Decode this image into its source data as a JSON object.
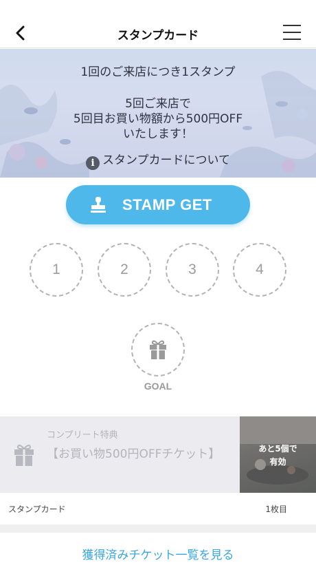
{
  "header": {
    "title": "スタンプカード",
    "back_icon": "chevron-left-icon",
    "menu_icon": "hamburger-menu-icon"
  },
  "banner": {
    "line1": "1回のご来店につき1スタンプ",
    "line2": "5回ご来店で",
    "line3": "5回目お買い物額から500円OFF",
    "line4": "いたします！",
    "info_link": "スタンプカードについて"
  },
  "stamp_button": {
    "label": "STAMP GET",
    "icon": "stamp-icon",
    "color": "#4fb8ea"
  },
  "stamps": {
    "slots": [
      "1",
      "2",
      "3",
      "4"
    ],
    "goal_label": "GOAL",
    "goal_icon": "gift-icon"
  },
  "reward": {
    "caption": "コンプリート特典",
    "name": "【お買い物500円OFFチケット】",
    "remaining_line1": "あと5個で",
    "remaining_line2": "有効"
  },
  "card_meta": {
    "label": "スタンプカード",
    "count": "1枚目"
  },
  "footer_link": "獲得済みチケット一覧を見る"
}
